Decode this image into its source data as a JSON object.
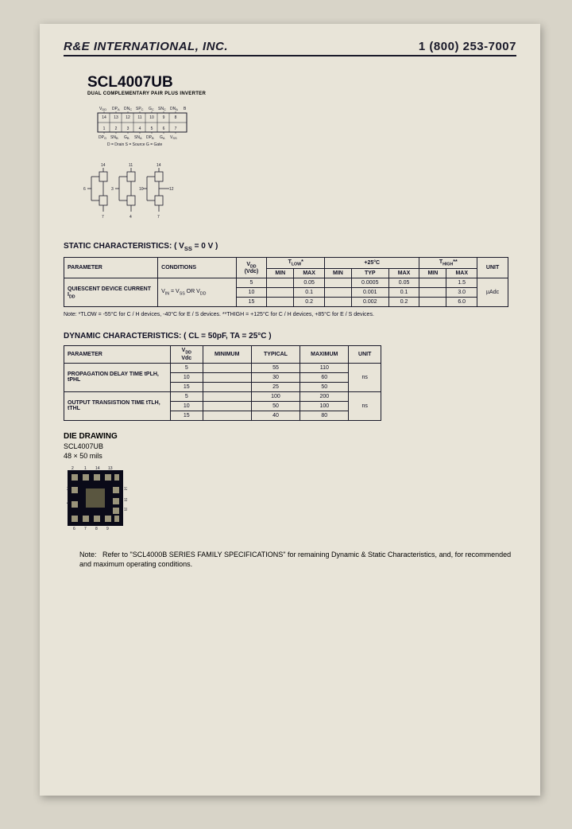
{
  "header": {
    "company_prefix": "R&E",
    "company_rest": " INTERNATIONAL, INC.",
    "phone": "1 (800) 253-7007"
  },
  "part": {
    "number": "SCL4007UB",
    "subtitle": "DUAL COMPLEMENTARY PAIR PLUS INVERTER"
  },
  "pin_labels_top": [
    "VDD",
    "DPA",
    "DNC",
    "SPC",
    "GC",
    "SNC",
    "DNA",
    "B"
  ],
  "pin_nums_top": [
    "14",
    "13",
    "12",
    "11",
    "10",
    "9",
    "8"
  ],
  "pin_nums_bot": [
    "1",
    "2",
    "3",
    "4",
    "5",
    "6",
    "7"
  ],
  "pin_labels_bot": [
    "DPG",
    "SNB",
    "GB",
    "SNA",
    "DPB",
    "GA",
    "VSS"
  ],
  "pin_legend": "D = Drain   S = Source   G = Gate",
  "static": {
    "title": "STATIC CHARACTERISTICS: ( V",
    "title_sub": "SS",
    "title_rest": " = 0 V )",
    "headers": {
      "parameter": "PARAMETER",
      "conditions": "CONDITIONS",
      "vdd": "V",
      "vdd_sub": "DD",
      "vdd_unit": "(Vdc)",
      "tlow": "T",
      "tlow_sub": "LOW",
      "tlow_star": "*",
      "min": "MIN",
      "max": "MAX",
      "t25": "+25°C",
      "typ": "TYP",
      "thigh": "T",
      "thigh_sub": "HIGH",
      "thigh_star": "**",
      "unit": "UNIT"
    },
    "param": "QUIESCENT DEVICE CURRENT   I",
    "param_sub": "DD",
    "cond_pre": "V",
    "cond_sub1": "IN",
    "cond_mid": " = V",
    "cond_sub2": "SS",
    "cond_or": " OR V",
    "cond_sub3": "DD",
    "rows": [
      {
        "vdd": "5",
        "tlow_min": "",
        "tlow_max": "0.05",
        "t25_min": "",
        "t25_typ": "0.0005",
        "t25_max": "0.05",
        "thigh_min": "",
        "thigh_max": "1.5"
      },
      {
        "vdd": "10",
        "tlow_min": "",
        "tlow_max": "0.1",
        "t25_min": "",
        "t25_typ": "0.001",
        "t25_max": "0.1",
        "thigh_min": "",
        "thigh_max": "3.0"
      },
      {
        "vdd": "15",
        "tlow_min": "",
        "tlow_max": "0.2",
        "t25_min": "",
        "t25_typ": "0.002",
        "t25_max": "0.2",
        "thigh_min": "",
        "thigh_max": "6.0"
      }
    ],
    "unit": "µAdc",
    "note": "Note: *TLOW = -55°C for C / H devices, -40°C for E / S devices. **THIGH = +125°C for C / H devices, +85°C for E / S devices."
  },
  "dynamic": {
    "title": "DYNAMIC CHARACTERISTICS: ( CL = 50pF, TA = 25°C )",
    "headers": {
      "parameter": "PARAMETER",
      "vdd": "V",
      "vdd_sub": "DD",
      "vdd_unit": "Vdc",
      "minimum": "MINIMUM",
      "typical": "TYPICAL",
      "maximum": "MAXIMUM",
      "unit": "UNIT"
    },
    "params": [
      {
        "name": "PROPAGATION DELAY TIME   tPLH, tPHL",
        "rows": [
          {
            "vdd": "5",
            "min": "",
            "typ": "55",
            "max": "110"
          },
          {
            "vdd": "10",
            "min": "",
            "typ": "30",
            "max": "60"
          },
          {
            "vdd": "15",
            "min": "",
            "typ": "25",
            "max": "50"
          }
        ],
        "unit": "ns"
      },
      {
        "name": "OUTPUT TRANSISTION TIME   tTLH, tTHL",
        "rows": [
          {
            "vdd": "5",
            "min": "",
            "typ": "100",
            "max": "200"
          },
          {
            "vdd": "10",
            "min": "",
            "typ": "50",
            "max": "100"
          },
          {
            "vdd": "15",
            "min": "",
            "typ": "40",
            "max": "80"
          }
        ],
        "unit": "ns"
      }
    ]
  },
  "die": {
    "title": "DIE DRAWING",
    "part": "SCL4007UB",
    "size": "48 × 50 mils"
  },
  "footnote_label": "Note:",
  "footnote": "Refer to \"SCL4000B SERIES FAMILY SPECIFICATIONS\" for remaining Dynamic & Static Characteristics, and, for recommended and maximum operating conditions."
}
